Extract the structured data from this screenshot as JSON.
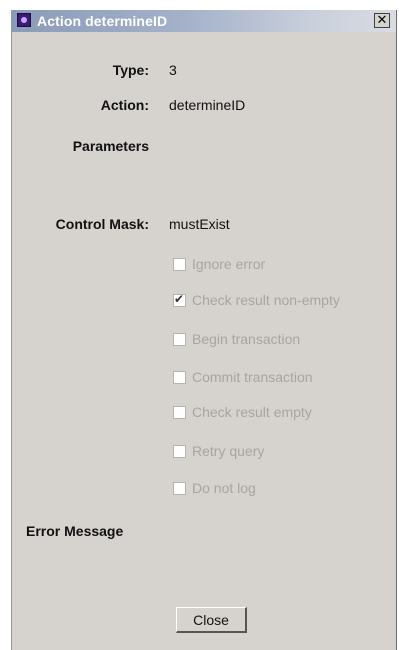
{
  "window": {
    "title": "Action determineID",
    "close_glyph": "✕",
    "icon": "app-icon"
  },
  "fields": {
    "type_label": "Type:",
    "type_value": "3",
    "action_label": "Action:",
    "action_value": "determineID",
    "parameters_label": "Parameters",
    "control_mask_label": "Control Mask:",
    "control_mask_value": "mustExist",
    "error_message_label": "Error Message"
  },
  "options": [
    {
      "label": "Ignore error",
      "checked": false,
      "enabled": false
    },
    {
      "label": "Check result non-empty",
      "checked": true,
      "enabled": false
    },
    {
      "label": "Begin transaction",
      "checked": false,
      "enabled": false
    },
    {
      "label": "Commit transaction",
      "checked": false,
      "enabled": false
    },
    {
      "label": "Check result empty",
      "checked": false,
      "enabled": false
    },
    {
      "label": "Retry query",
      "checked": false,
      "enabled": false
    },
    {
      "label": "Do not log",
      "checked": false,
      "enabled": false
    }
  ],
  "buttons": {
    "close_label": "Close"
  }
}
